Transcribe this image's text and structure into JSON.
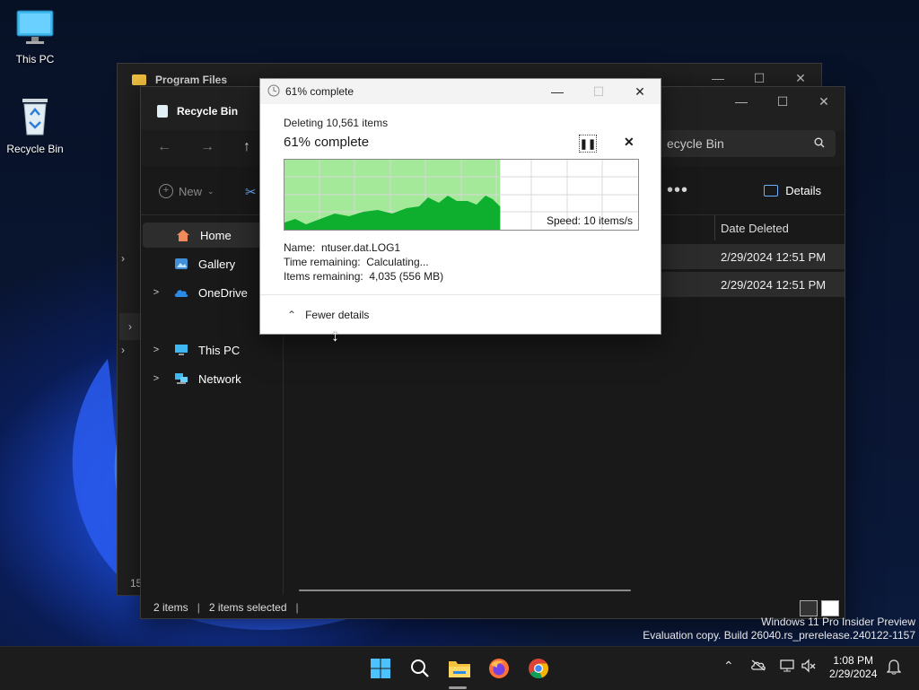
{
  "desktop": {
    "icons": [
      {
        "label": "This PC"
      },
      {
        "label": "Recycle Bin"
      }
    ],
    "watermark": {
      "line1": "Windows 11 Pro Insider Preview",
      "line2": "Evaluation copy. Build 26040.rs_prerelease.240122-1157"
    }
  },
  "back_window": {
    "title": "Program Files"
  },
  "explorer": {
    "tab_title": "Recycle Bin",
    "search_value": "ecycle Bin",
    "toolbar": {
      "new_label": "New",
      "more_label": "•••",
      "details_label": "Details"
    },
    "sidebar": [
      {
        "label": "Home",
        "expandable": false,
        "active": true
      },
      {
        "label": "Gallery",
        "expandable": false
      },
      {
        "label": "OneDrive",
        "expandable": true
      },
      {
        "label": "This PC",
        "expandable": true
      },
      {
        "label": "Network",
        "expandable": true
      }
    ],
    "columns": {
      "date_deleted": "Date Deleted"
    },
    "rows": [
      {
        "date_deleted": "2/29/2024 12:51 PM"
      },
      {
        "date_deleted": "2/29/2024 12:51 PM"
      }
    ],
    "status": {
      "item_count": "2 items",
      "selected_count": "2 items selected"
    },
    "back_status_partial": "15"
  },
  "progress_dialog": {
    "title": "61% complete",
    "subtitle": "Deleting 10,561 items",
    "heading": "61% complete",
    "percent": 61,
    "speed_label": "Speed: 10 items/s",
    "name_label": "Name:",
    "name_value": "ntuser.dat.LOG1",
    "time_label": "Time remaining:",
    "time_value": "Calculating...",
    "items_label": "Items remaining:",
    "items_value": "4,035 (556 MB)",
    "fewer_details_label": "Fewer details"
  },
  "taskbar": {
    "apps": [
      {
        "name": "start-icon"
      },
      {
        "name": "search-icon"
      },
      {
        "name": "file-explorer-icon"
      },
      {
        "name": "firefox-icon"
      },
      {
        "name": "chrome-icon"
      }
    ],
    "time": "1:08 PM",
    "date": "2/29/2024"
  }
}
